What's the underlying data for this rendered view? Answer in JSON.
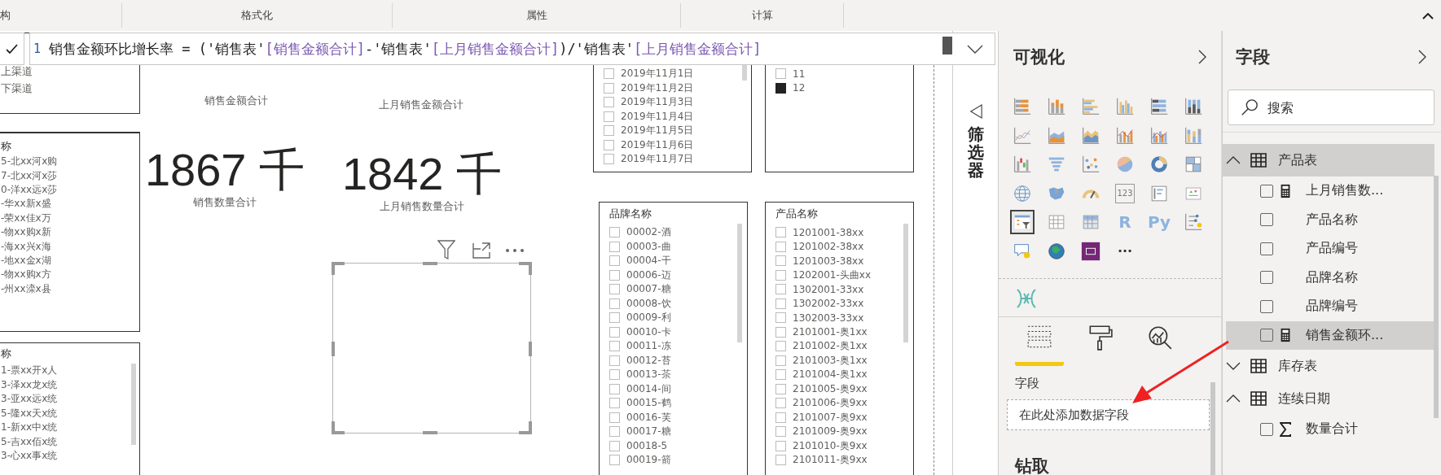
{
  "ribbon": {
    "groups": [
      {
        "label": "构"
      },
      {
        "label": "格式化"
      },
      {
        "label": "属性"
      },
      {
        "label": "计算"
      }
    ]
  },
  "formula_bar": {
    "line_number": "1",
    "tokens": [
      {
        "kind": "text",
        "text": "销售金额环比增长率 = ('销售表'"
      },
      {
        "kind": "column",
        "text": "[销售金额合计]"
      },
      {
        "kind": "text",
        "text": "-'销售表'"
      },
      {
        "kind": "column",
        "text": "[上月销售金额合计]"
      },
      {
        "kind": "text",
        "text": ")/'销售表'"
      },
      {
        "kind": "column",
        "text": "[上月销售金额合计]"
      }
    ]
  },
  "canvas": {
    "slicers": [
      {
        "items": [
          {
            "label": "上渠道"
          },
          {
            "label": "下渠道"
          }
        ]
      },
      {
        "title": "称",
        "items": [
          {
            "label": "5-北xx河x购"
          },
          {
            "label": "7-北xx河x莎"
          },
          {
            "label": "0-洋xx远x莎"
          },
          {
            "label": "-华xx新x盛"
          },
          {
            "label": "-荣xx佳x万"
          },
          {
            "label": "-物xx购x新"
          },
          {
            "label": "-海xx兴x海"
          },
          {
            "label": "-地xx金x湖"
          },
          {
            "label": "-物xx购x方"
          },
          {
            "label": "-州xx滦x县"
          }
        ]
      },
      {
        "title": "称",
        "items": [
          {
            "label": "1-票xx开x人"
          },
          {
            "label": "3-泽xx龙x统"
          },
          {
            "label": "3-亚xx远x统"
          },
          {
            "label": "5-隆xx天x统"
          },
          {
            "label": "1-新xx中x统"
          },
          {
            "label": "5-吉xx佰x统"
          },
          {
            "label": "3-心xx事x统"
          }
        ]
      },
      {
        "items": [
          {
            "label": "2019年11月1日",
            "checked": false
          },
          {
            "label": "2019年11月2日",
            "checked": false
          },
          {
            "label": "2019年11月3日",
            "checked": false
          },
          {
            "label": "2019年11月4日",
            "checked": false
          },
          {
            "label": "2019年11月5日",
            "checked": false
          },
          {
            "label": "2019年11月6日",
            "checked": false
          },
          {
            "label": "2019年11月7日",
            "checked": false
          }
        ]
      },
      {
        "items": [
          {
            "label": "11",
            "checked": false
          },
          {
            "label": "12",
            "checked": true
          }
        ]
      },
      {
        "title": "品牌名称",
        "items": [
          {
            "label": "00002-酒",
            "checked": false
          },
          {
            "label": "00003-曲",
            "checked": false
          },
          {
            "label": "00004-干",
            "checked": false
          },
          {
            "label": "00006-迈",
            "checked": false
          },
          {
            "label": "00007-糖",
            "checked": false
          },
          {
            "label": "00008-饮",
            "checked": false
          },
          {
            "label": "00009-利",
            "checked": false
          },
          {
            "label": "00010-卡",
            "checked": false
          },
          {
            "label": "00011-冻",
            "checked": false
          },
          {
            "label": "00012-苔",
            "checked": false
          },
          {
            "label": "00013-茶",
            "checked": false
          },
          {
            "label": "00014-间",
            "checked": false
          },
          {
            "label": "00015-鹤",
            "checked": false
          },
          {
            "label": "00016-芙",
            "checked": false
          },
          {
            "label": "00017-糖",
            "checked": false
          },
          {
            "label": "00018-5",
            "checked": false
          },
          {
            "label": "00019-箭",
            "checked": false
          }
        ]
      },
      {
        "title": "产品名称",
        "items": [
          {
            "label": "1201001-38xx",
            "checked": false
          },
          {
            "label": "1201002-38xx",
            "checked": false
          },
          {
            "label": "1201003-38xx",
            "checked": false
          },
          {
            "label": "1202001-头曲xx",
            "checked": false
          },
          {
            "label": "1302001-33xx",
            "checked": false
          },
          {
            "label": "1302002-33xx",
            "checked": false
          },
          {
            "label": "1302003-33xx",
            "checked": false
          },
          {
            "label": "2101001-奥1xx",
            "checked": false
          },
          {
            "label": "2101002-奥1xx",
            "checked": false
          },
          {
            "label": "2101003-奥1xx",
            "checked": false
          },
          {
            "label": "2101004-奥1xx",
            "checked": false
          },
          {
            "label": "2101005-奥9xx",
            "checked": false
          },
          {
            "label": "2101006-奥9xx",
            "checked": false
          },
          {
            "label": "2101007-奥9xx",
            "checked": false
          },
          {
            "label": "2101009-奥9xx",
            "checked": false
          },
          {
            "label": "2101010-奥9xx",
            "checked": false
          },
          {
            "label": "2101011-奥9xx",
            "checked": false
          }
        ]
      }
    ],
    "cards": [
      {
        "label": "销售金额合计"
      },
      {
        "label": "上月销售金额合计"
      },
      {
        "value": "1867 千",
        "label": "销售数量合计"
      },
      {
        "value": "1842 千",
        "label": "上月销售数量合计"
      }
    ]
  },
  "filters_pane": {
    "title": "筛选器"
  },
  "visualizations_pane": {
    "title": "可视化",
    "visuals": [
      {
        "kind": "stacked-bar-chart",
        "selected": false
      },
      {
        "kind": "stacked-column-chart",
        "selected": false
      },
      {
        "kind": "clustered-bar-chart",
        "selected": false
      },
      {
        "kind": "clustered-column-chart",
        "selected": false
      },
      {
        "kind": "full-stacked-bar-chart",
        "selected": false
      },
      {
        "kind": "full-stacked-column-chart",
        "selected": false
      },
      {
        "kind": "line-chart",
        "selected": false
      },
      {
        "kind": "area-chart",
        "selected": false
      },
      {
        "kind": "stacked-area-chart",
        "selected": false
      },
      {
        "kind": "line-column-chart",
        "selected": false
      },
      {
        "kind": "line-clustered-column-chart",
        "selected": false
      },
      {
        "kind": "ribbon-chart",
        "selected": false
      },
      {
        "kind": "waterfall-chart",
        "selected": false
      },
      {
        "kind": "funnel-chart",
        "selected": false
      },
      {
        "kind": "scatter-chart",
        "selected": false
      },
      {
        "kind": "pie-chart",
        "selected": false
      },
      {
        "kind": "donut-chart",
        "selected": false
      },
      {
        "kind": "treemap-chart",
        "selected": false
      },
      {
        "kind": "globe-map",
        "selected": false
      },
      {
        "kind": "filled-map",
        "selected": false
      },
      {
        "kind": "gauge-chart",
        "selected": false
      },
      {
        "kind": "card-visual",
        "selected": false,
        "label": "123"
      },
      {
        "kind": "multi-row-card",
        "selected": false
      },
      {
        "kind": "kpi-visual",
        "selected": false
      },
      {
        "kind": "slicer-visual",
        "selected": true
      },
      {
        "kind": "table-visual",
        "selected": false
      },
      {
        "kind": "matrix-visual",
        "selected": false
      },
      {
        "kind": "r-script-visual",
        "selected": false,
        "label": "R"
      },
      {
        "kind": "python-visual",
        "selected": false,
        "label": "Py"
      },
      {
        "kind": "key-influencers-visual",
        "selected": false
      },
      {
        "kind": "qa-visual",
        "selected": false
      },
      {
        "kind": "arcgis-globe",
        "selected": false
      },
      {
        "kind": "power-apps-visual",
        "selected": false
      },
      {
        "kind": "more-visuals",
        "selected": false,
        "label": "···"
      }
    ],
    "tabs": [
      {
        "kind": "fields",
        "selected": true
      },
      {
        "kind": "format",
        "selected": false
      },
      {
        "kind": "analytics",
        "selected": false
      }
    ],
    "well": {
      "label": "字段",
      "placeholder": "在此处添加数据字段"
    },
    "drillthrough": {
      "title": "钻取"
    }
  },
  "fields_pane": {
    "title": "字段",
    "search": {
      "placeholder": "搜索"
    },
    "tables": [
      {
        "name": "产品表",
        "expanded": true,
        "selected": true,
        "children": [
          {
            "kind": "measure",
            "name": "上月销售数...",
            "checked": false,
            "selected": false
          },
          {
            "kind": "column",
            "name": "产品名称",
            "checked": false,
            "selected": false
          },
          {
            "kind": "column",
            "name": "产品编号",
            "checked": false,
            "selected": false
          },
          {
            "kind": "column",
            "name": "品牌名称",
            "checked": false,
            "selected": false
          },
          {
            "kind": "column",
            "name": "品牌编号",
            "checked": false,
            "selected": false
          },
          {
            "kind": "measure",
            "name": "销售金额环...",
            "checked": false,
            "selected": true
          }
        ]
      },
      {
        "name": "库存表",
        "expanded": false,
        "selected": false
      },
      {
        "name": "连续日期",
        "expanded": true,
        "selected": false,
        "children": [
          {
            "kind": "sum",
            "name": "数量合计",
            "checked": false,
            "selected": false
          }
        ]
      }
    ]
  }
}
